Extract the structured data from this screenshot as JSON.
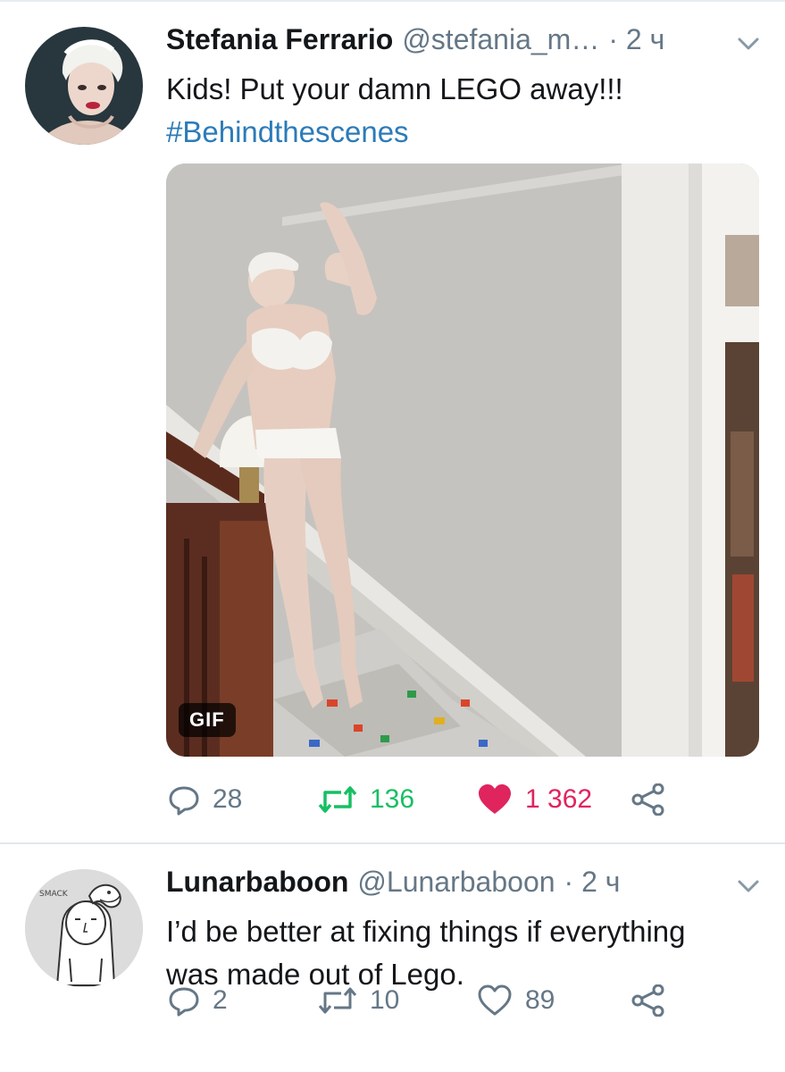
{
  "tweets": [
    {
      "name": "Stefania Ferrario",
      "handle": "@stefania_m…",
      "time": "· 2 ч",
      "text": "Kids! Put your damn LEGO away!!!",
      "hashtag": "#Behindthescenes",
      "media_badge": "GIF",
      "replies": "28",
      "retweets": "136",
      "likes": "1 362",
      "retweeted": true,
      "liked": true
    },
    {
      "name": "Lunarbaboon",
      "handle": "@Lunarbaboon",
      "time": "· 2 ч",
      "text_line1": "I’d be better at fixing things if everything",
      "text_line2": "was made out of Lego.",
      "replies": "2",
      "retweets": "10",
      "likes": "89",
      "retweeted": false,
      "liked": false
    }
  ],
  "colors": {
    "link": "#2b7bb9",
    "retweet_active": "#17bf63",
    "like_active": "#e0245e",
    "secondary": "#657786"
  },
  "icons": [
    "chevron-down-icon",
    "reply-icon",
    "retweet-icon",
    "heart-icon",
    "share-icon"
  ]
}
